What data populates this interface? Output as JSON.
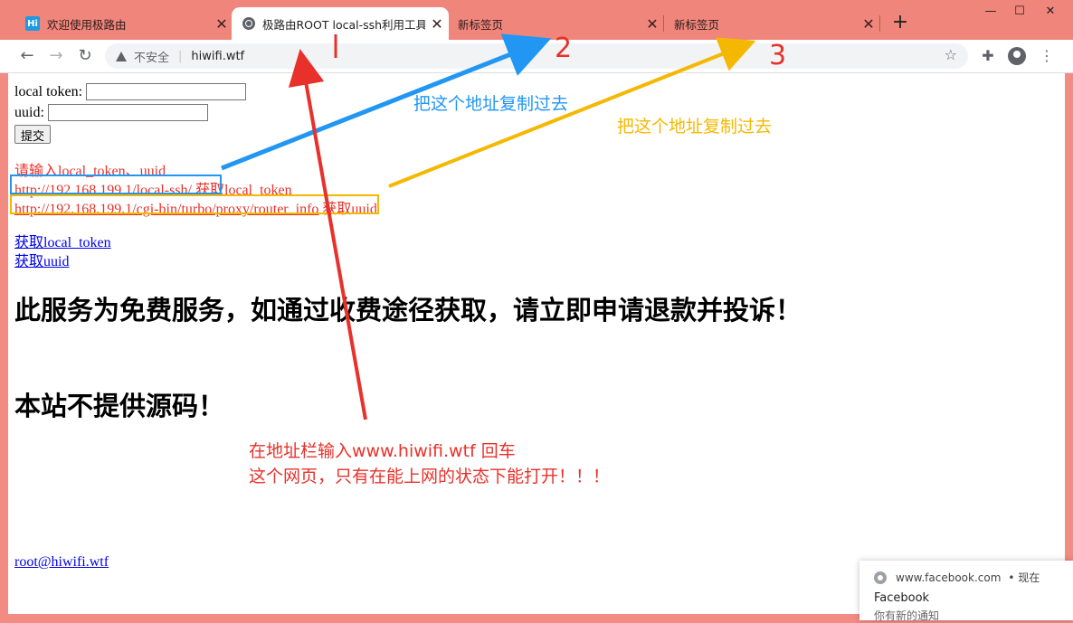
{
  "tabs": [
    {
      "title": "欢迎使用极路由",
      "favicon": "hi-icon",
      "favicon_text": "Hi"
    },
    {
      "title": "极路由ROOT local-ssh利用工具",
      "favicon": "globe-icon"
    },
    {
      "title": "新标签页"
    },
    {
      "title": "新标签页"
    }
  ],
  "toolbar": {
    "insecure_label": "不安全",
    "url": "hiwifi.wtf"
  },
  "form": {
    "token_label": "local token:",
    "token_value": "",
    "uuid_label": "uuid:",
    "uuid_value": "",
    "submit_label": "提交"
  },
  "instructions": {
    "prompt": "请输入local_token、uuid",
    "url1": "http://192.168.199.1/local-ssh/",
    "url1_note": " 获取local_token",
    "url2": "http://192.168.199.1/cgi-bin/turbo/proxy/router_info",
    "url2_note": " 获取uuid"
  },
  "links": {
    "get_token": "获取local_token",
    "get_uuid": "获取uuid",
    "email": "root@hiwifi.wtf"
  },
  "headings": {
    "free_notice": "此服务为免费服务，如通过收费途径获取，请立即申请退款并投诉！",
    "no_source": "本站不提供源码！"
  },
  "annotations": {
    "copy_blue": "把这个地址复制过去",
    "copy_yellow": "把这个地址复制过去",
    "num2": "2",
    "num3": "3",
    "instruction_line1": "在地址栏输入www.hiwifi.wtf 回车",
    "instruction_line2": "这个网页，只有在能上网的状态下能打开！！！",
    "colors": {
      "blue": "#2196f3",
      "yellow": "#f5b800",
      "red": "#e8312a"
    }
  },
  "notification": {
    "source": "www.facebook.com",
    "time": "• 现在",
    "title": "Facebook",
    "body": "你有新的通知"
  }
}
